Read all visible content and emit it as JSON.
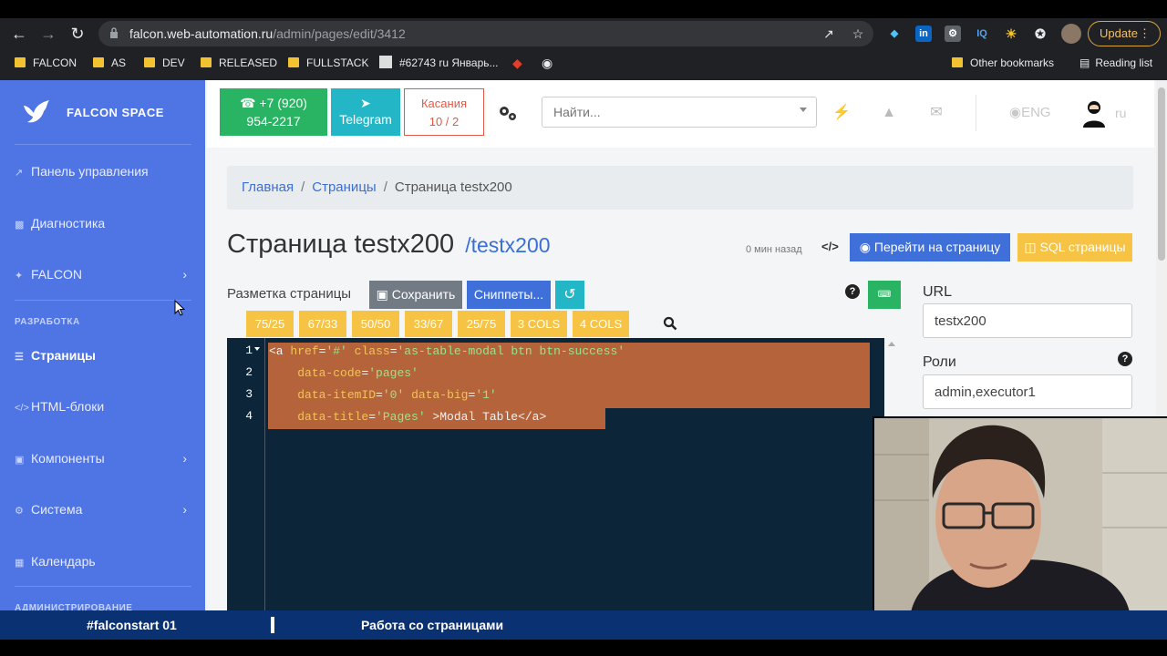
{
  "browser": {
    "url_host": "falcon.web-automation.ru",
    "url_path": "/admin/pages/edit/3412",
    "update_label": "Update",
    "bookmarks": [
      "FALCON",
      "AS",
      "DEV",
      "RELEASED",
      "FULLSTACK",
      "#62743 ru Январь..."
    ],
    "other_bookmarks": "Other bookmarks",
    "reading_list": "Reading list"
  },
  "sidebar": {
    "brand": "FALCON SPACE",
    "items": [
      {
        "label": "Панель управления"
      },
      {
        "label": "Диагностика"
      },
      {
        "label": "FALCON"
      },
      {
        "label": "Страницы"
      },
      {
        "label": "HTML-блоки"
      },
      {
        "label": "Компоненты"
      },
      {
        "label": "Система"
      },
      {
        "label": "Календарь"
      }
    ],
    "section_dev": "РАЗРАБОТКА",
    "section_admin": "АДМИНИСТРИРОВАНИЕ"
  },
  "header": {
    "phone_line1": "+7 (920)",
    "phone_line2": "954-2217",
    "telegram": "Telegram",
    "touch_line1": "Касания",
    "touch_line2": "10 / 2",
    "search_placeholder": "Найти...",
    "lang": "ENG",
    "locale": "ru"
  },
  "breadcrumb": {
    "home": "Главная",
    "pages": "Страницы",
    "current": "Страница testx200"
  },
  "page": {
    "title": "Страница testx200",
    "slug": "/testx200",
    "updated": "0 мин назад",
    "goto_label": "Перейти на страницу",
    "sql_label": "SQL страницы"
  },
  "editor_toolbar": {
    "markup_label": "Разметка страницы",
    "save": "Сохранить",
    "snippets": "Сниппеты...",
    "help": "?",
    "columns": [
      "75/25",
      "67/33",
      "50/50",
      "33/67",
      "25/75",
      "3 COLS",
      "4 COLS"
    ]
  },
  "code": {
    "line_numbers": [
      "1",
      "2",
      "3",
      "4"
    ],
    "l1_tag": "<a",
    "l1_a1": "href",
    "l1_v1": "'#'",
    "l1_a2": "class",
    "l1_v2": "'as-table-modal btn btn-success'",
    "l2_a": "data-code",
    "l2_v": "'pages'",
    "l3_a1": "data-itemID",
    "l3_v1": "'0'",
    "l3_a2": "data-big",
    "l3_v2": "'1'",
    "l4_a": "data-title",
    "l4_v": "'Pages'",
    "l4_rest": " >Modal Table</a>"
  },
  "form": {
    "url_label": "URL",
    "url_value": "testx200",
    "roles_label": "Роли",
    "roles_value": "admin,executor1",
    "help": "?"
  },
  "lower_third": {
    "tag": "#falconstart 01",
    "topic": "Работа со страницами"
  },
  "colors": {
    "sidebar": "#4f74e3",
    "success": "#28b463",
    "info": "#23b6c6",
    "primary": "#3f6fd8",
    "warning": "#f6c344",
    "editor_bg": "#0d2538"
  }
}
